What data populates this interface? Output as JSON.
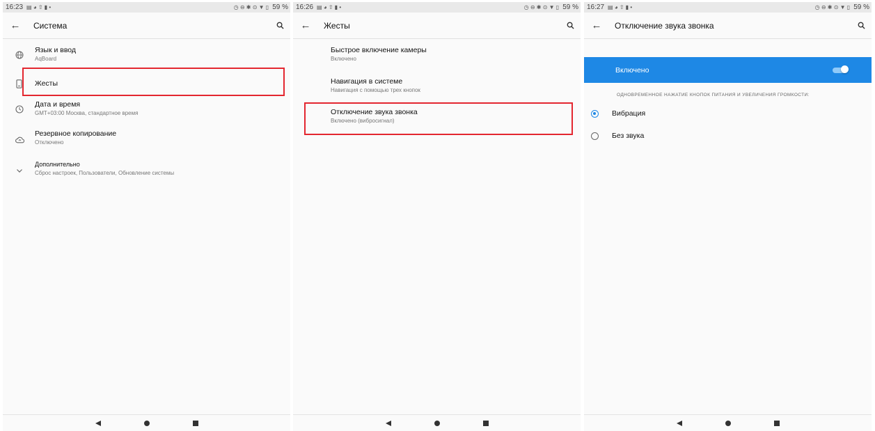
{
  "screens": [
    {
      "status_time": "16:23",
      "status_right": "59 %",
      "title": "Система",
      "items": [
        {
          "title": "Язык и ввод",
          "subtitle": "AqBoard",
          "icon": "globe-icon"
        },
        {
          "title": "Жесты",
          "subtitle": "",
          "icon": "phone-gesture-icon"
        },
        {
          "title": "Дата и время",
          "subtitle": "GMT+03:00 Москва, стандартное время",
          "icon": "clock-icon"
        },
        {
          "title": "Резервное копирование",
          "subtitle": "Отключено",
          "icon": "cloud-backup-icon"
        },
        {
          "title": "Дополнительно",
          "subtitle": "Сброс настроек, Пользователи, Обновление системы",
          "icon": "chevron-down-icon"
        }
      ]
    },
    {
      "status_time": "16:26",
      "status_right": "59 %",
      "title": "Жесты",
      "items": [
        {
          "title": "Быстрое включение камеры",
          "subtitle": "Включено"
        },
        {
          "title": "Навигация в системе",
          "subtitle": "Навигация с помощью трех кнопок"
        },
        {
          "title": "Отключение звука звонка",
          "subtitle": "Включено (вибросигнал)"
        }
      ]
    },
    {
      "status_time": "16:27",
      "status_right": "59 %",
      "title": "Отключение звука звонка",
      "toggle_label": "Включено",
      "toggle_on": true,
      "caption": "ОДНОВРЕМЕННОЕ НАЖАТИЕ КНОПОК ПИТАНИЯ И УВЕЛИЧЕНИЯ ГРОМКОСТИ:",
      "options": [
        {
          "label": "Вибрация",
          "selected": true
        },
        {
          "label": "Без звука",
          "selected": false
        }
      ]
    }
  ],
  "colors": {
    "accent": "#1e88e5",
    "highlight": "#e3262f"
  }
}
